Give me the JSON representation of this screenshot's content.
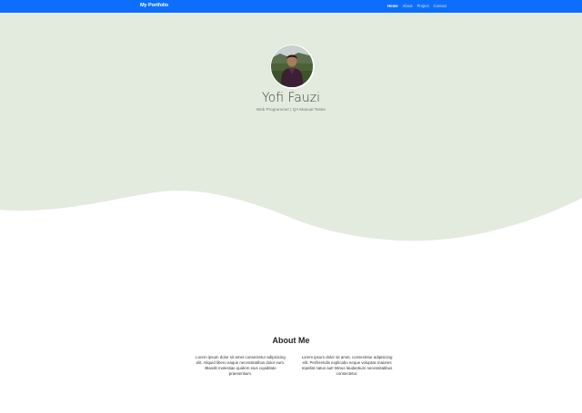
{
  "navbar": {
    "brand": "My Portfolio",
    "links": [
      {
        "label": "Home",
        "active": true
      },
      {
        "label": "About",
        "active": false
      },
      {
        "label": "Project",
        "active": false
      },
      {
        "label": "Contact",
        "active": false
      }
    ],
    "bg_color": "#0d6efd"
  },
  "hero": {
    "name": "Yofi Fauzi",
    "subtitle": "Web Programmer | QA Manual Tester",
    "bg_color": "#e2ebde"
  },
  "about": {
    "title": "About Me",
    "paragraphs": [
      "Lorem ipsum dolor sit amet consectetur adipisicing elit. Aliquid libero eaque necessitatibus dolor eum. Blandit molestiae quidem eius cupiditate praesentium.",
      "Lorem ipsum dolor sit amet, consectetur adipisicing elit. Perferendis explicabo neque voluptas maiores repellat natus aut! Minus laudantium necessitatibus consectetur."
    ]
  }
}
